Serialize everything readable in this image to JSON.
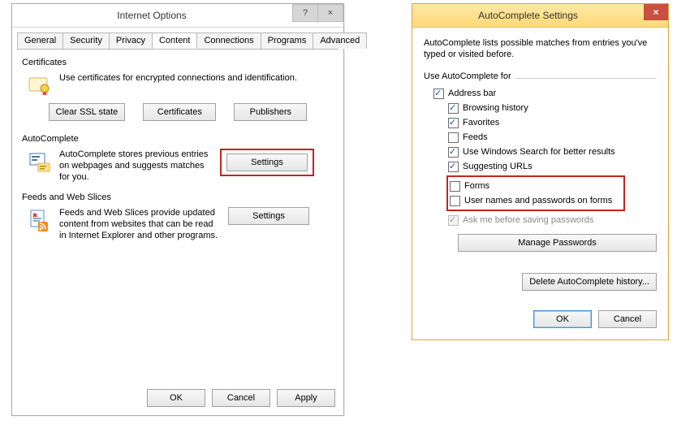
{
  "io": {
    "title": "Internet Options",
    "help_label": "?",
    "close_label": "×",
    "tabs": [
      "General",
      "Security",
      "Privacy",
      "Content",
      "Connections",
      "Programs",
      "Advanced"
    ],
    "active_tab": 3,
    "certificates": {
      "legend": "Certificates",
      "text": "Use certificates for encrypted connections and identification.",
      "clear_btn": "Clear SSL state",
      "certs_btn": "Certificates",
      "pubs_btn": "Publishers"
    },
    "autocomplete": {
      "legend": "AutoComplete",
      "text": "AutoComplete stores previous entries on webpages and suggests matches for you.",
      "settings_btn": "Settings"
    },
    "feeds": {
      "legend": "Feeds and Web Slices",
      "text": "Feeds and Web Slices provide updated content from websites that can be read in Internet Explorer and other programs.",
      "settings_btn": "Settings"
    },
    "footer": {
      "ok": "OK",
      "cancel": "Cancel",
      "apply": "Apply"
    }
  },
  "ac": {
    "title": "AutoComplete Settings",
    "close_label": "×",
    "intro": "AutoComplete lists possible matches from entries you've typed or visited before.",
    "group_label": "Use AutoComplete for",
    "items": {
      "address_bar": {
        "label": "Address bar",
        "checked": true
      },
      "browsing_history": {
        "label": "Browsing history",
        "checked": true
      },
      "favorites": {
        "label": "Favorites",
        "checked": true
      },
      "feeds": {
        "label": "Feeds",
        "checked": false
      },
      "windows_search": {
        "label": "Use Windows Search for better results",
        "checked": true
      },
      "suggesting_urls": {
        "label": "Suggesting URLs",
        "checked": true
      },
      "forms": {
        "label": "Forms",
        "checked": false
      },
      "user_pass": {
        "label": "User names and passwords on forms",
        "checked": false
      },
      "ask_before": {
        "label": "Ask me before saving passwords",
        "checked": true,
        "disabled": true
      }
    },
    "manage_btn": "Manage Passwords",
    "delete_btn": "Delete AutoComplete history...",
    "ok": "OK",
    "cancel": "Cancel"
  }
}
